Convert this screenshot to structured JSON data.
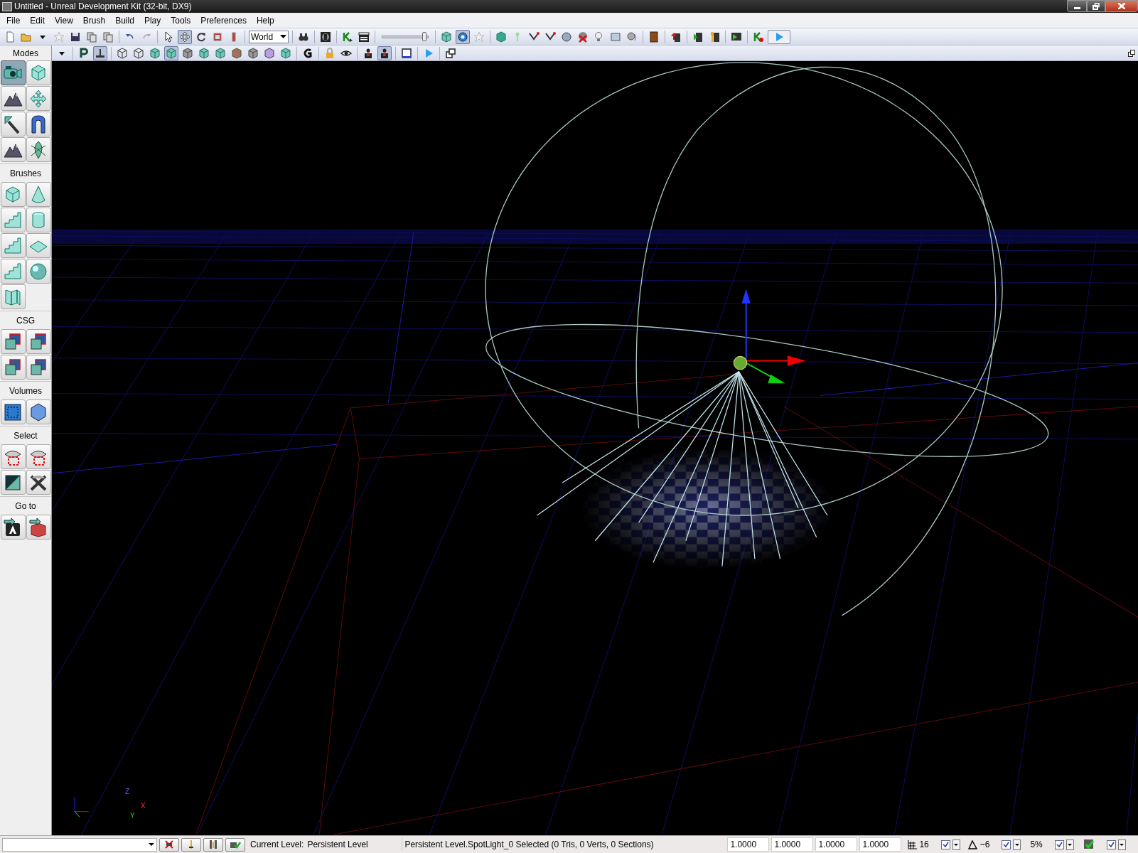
{
  "window": {
    "title": "Untitled - Unreal Development Kit (32-bit, DX9)",
    "controls": [
      {
        "kind": "minimize"
      },
      {
        "kind": "restore"
      },
      {
        "kind": "close"
      }
    ]
  },
  "menu": [
    "File",
    "Edit",
    "View",
    "Brush",
    "Build",
    "Play",
    "Tools",
    "Preferences",
    "Help"
  ],
  "toolbar_1": [
    {
      "kind": "new",
      "pressed": false
    },
    {
      "kind": "open",
      "pressed": false
    },
    {
      "kind": "caret",
      "pressed": false
    },
    {
      "kind": "star",
      "pressed": false
    },
    {
      "kind": "save",
      "pressed": false
    },
    {
      "kind": "pages",
      "pressed": false
    },
    {
      "kind": "pages",
      "pressed": false
    },
    {
      "kind": "separator"
    },
    {
      "kind": "undo",
      "pressed": false
    },
    {
      "kind": "redo",
      "pressed": false
    },
    {
      "kind": "separator"
    },
    {
      "kind": "pointer",
      "pressed": false
    },
    {
      "kind": "move",
      "pressed": true
    },
    {
      "kind": "rotate",
      "pressed": false
    },
    {
      "kind": "square",
      "pressed": false
    },
    {
      "kind": "bar",
      "pressed": false
    },
    {
      "kind": "separator"
    },
    {
      "kind": "dropdown",
      "text": "World"
    },
    {
      "kind": "separator"
    },
    {
      "kind": "binoculars",
      "pressed": false
    },
    {
      "kind": "separator"
    },
    {
      "kind": "emblem",
      "pressed": false
    },
    {
      "kind": "separator"
    },
    {
      "kind": "kletter",
      "pressed": false
    },
    {
      "kind": "clapper",
      "pressed": false
    },
    {
      "kind": "separator"
    },
    {
      "kind": "slider",
      "level": 0.92
    },
    {
      "kind": "separator"
    },
    {
      "kind": "cube",
      "pressed": false
    },
    {
      "kind": "sphere",
      "pressed": true
    },
    {
      "kind": "star",
      "pressed": false
    },
    {
      "kind": "separator"
    },
    {
      "kind": "shield",
      "pressed": false
    },
    {
      "kind": "key",
      "pressed": false
    },
    {
      "kind": "path",
      "pressed": false
    },
    {
      "kind": "path",
      "pressed": false
    },
    {
      "kind": "ball",
      "pressed": false
    },
    {
      "kind": "cross",
      "pressed": false
    },
    {
      "kind": "bulb",
      "pressed": false
    },
    {
      "kind": "screen",
      "pressed": false
    },
    {
      "kind": "speaker",
      "pressed": false
    },
    {
      "kind": "separator"
    },
    {
      "kind": "book",
      "pressed": false
    },
    {
      "kind": "separator"
    },
    {
      "kind": "upload",
      "pressed": false
    },
    {
      "kind": "separator"
    },
    {
      "kind": "playdoc",
      "pressed": false
    },
    {
      "kind": "wrench",
      "pressed": false
    },
    {
      "kind": "separator"
    },
    {
      "kind": "monitor",
      "pressed": false
    },
    {
      "kind": "separator"
    },
    {
      "kind": "krecord",
      "pressed": false
    },
    {
      "kind": "play",
      "pressed": false
    }
  ],
  "toolbar_2": [
    {
      "kind": "caret",
      "pressed": false
    },
    {
      "kind": "separator"
    },
    {
      "kind": "pletter",
      "pressed": false
    },
    {
      "kind": "pivot",
      "pressed": true
    },
    {
      "kind": "separator"
    },
    {
      "kind": "wirecube",
      "pressed": false
    },
    {
      "kind": "wirecube",
      "pressed": false
    },
    {
      "kind": "cube",
      "pressed": false
    },
    {
      "kind": "cube",
      "pressed": true
    },
    {
      "kind": "greycube",
      "pressed": false
    },
    {
      "kind": "cube",
      "pressed": false
    },
    {
      "kind": "cube",
      "pressed": false
    },
    {
      "kind": "browncube",
      "pressed": false
    },
    {
      "kind": "greycube",
      "pressed": false
    },
    {
      "kind": "purplecube",
      "pressed": false
    },
    {
      "kind": "cube",
      "pressed": false
    },
    {
      "kind": "separator"
    },
    {
      "kind": "gletter",
      "pressed": false
    },
    {
      "kind": "separator"
    },
    {
      "kind": "lock",
      "pressed": false
    },
    {
      "kind": "eye",
      "pressed": false
    },
    {
      "kind": "separator"
    },
    {
      "kind": "figure",
      "pressed": false
    },
    {
      "kind": "figure",
      "pressed": true
    },
    {
      "kind": "separator"
    },
    {
      "kind": "frame",
      "pressed": false
    },
    {
      "kind": "separator"
    },
    {
      "kind": "play",
      "pressed": false
    },
    {
      "kind": "separator"
    },
    {
      "kind": "window",
      "pressed": false
    }
  ],
  "tool_panel": [
    {
      "title": "Modes",
      "tools": [
        {
          "kind": "camera",
          "selected": true
        },
        {
          "kind": "cube",
          "selected": false
        },
        {
          "kind": "terrain",
          "selected": false
        },
        {
          "kind": "move",
          "selected": false
        },
        {
          "kind": "brush",
          "selected": false
        },
        {
          "kind": "arch",
          "selected": false
        },
        {
          "kind": "terrain",
          "selected": false
        },
        {
          "kind": "leaf",
          "selected": false
        }
      ]
    },
    {
      "title": "Brushes",
      "tools": [
        {
          "kind": "cube",
          "selected": false
        },
        {
          "kind": "cone",
          "selected": false
        },
        {
          "kind": "stairs",
          "selected": false
        },
        {
          "kind": "cylinder",
          "selected": false
        },
        {
          "kind": "stairs",
          "selected": false
        },
        {
          "kind": "plane",
          "selected": false
        },
        {
          "kind": "stairs",
          "selected": false
        },
        {
          "kind": "sphere",
          "selected": false
        },
        {
          "kind": "sheet",
          "selected": false
        }
      ]
    },
    {
      "title": "CSG",
      "tools": [
        {
          "kind": "csg",
          "selected": false
        },
        {
          "kind": "csg",
          "selected": false
        },
        {
          "kind": "csg",
          "selected": false
        },
        {
          "kind": "csg",
          "selected": false
        }
      ]
    },
    {
      "title": "Volumes",
      "tools": [
        {
          "kind": "volume",
          "selected": false
        },
        {
          "kind": "gem",
          "selected": false
        }
      ]
    },
    {
      "title": "Select",
      "tools": [
        {
          "kind": "eyeselect",
          "selected": false
        },
        {
          "kind": "eyeselect",
          "selected": false
        },
        {
          "kind": "invert",
          "selected": false
        },
        {
          "kind": "deselect",
          "selected": false
        }
      ]
    },
    {
      "title": "Go to",
      "tools": [
        {
          "kind": "gotoa",
          "selected": false
        },
        {
          "kind": "gotobox",
          "selected": false
        }
      ]
    }
  ],
  "viewport": {
    "axis_labels": [
      "Z",
      "X",
      "Y"
    ]
  },
  "status_bar": {
    "level_label": "Current Level:",
    "level_value": "Persistent Level",
    "selection": "Persistent Level.SpotLight_0 Selected (0 Tris, 0 Verts, 0 Sections)",
    "fields": [
      "1.0000",
      "1.0000",
      "1.0000",
      "1.0000"
    ],
    "grid": "16",
    "rotation": "~6",
    "scale": "5%",
    "checks": [
      true,
      true,
      true,
      true
    ]
  }
}
